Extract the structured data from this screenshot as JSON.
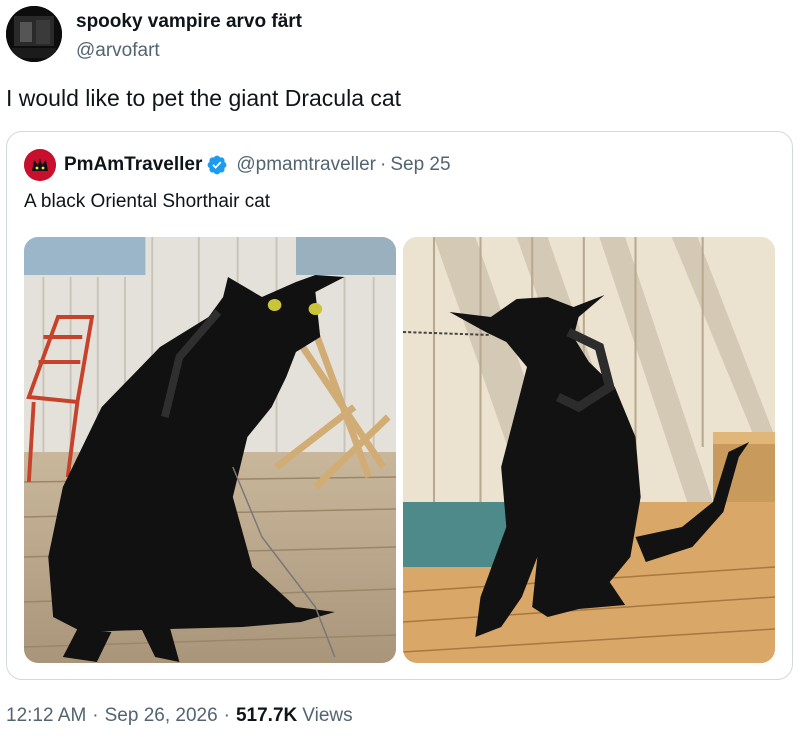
{
  "author": {
    "display_name": "spooky vampire arvo färt",
    "handle": "@arvofart",
    "avatar_icon": "profile-avatar"
  },
  "tweet": {
    "text": "I would like to pet the giant Dracula cat"
  },
  "quoted_tweet": {
    "display_name": "PmAmTraveller",
    "verified_icon": "verified-badge-icon",
    "handle": "@pmamtraveller",
    "separator": "·",
    "date": "Sep 25",
    "text": "A black Oriental Shorthair cat",
    "media": [
      {
        "name": "photo-cat-sitting-deck"
      },
      {
        "name": "photo-cat-sitting-sunlight"
      }
    ]
  },
  "meta": {
    "time": "12:12 AM",
    "sep1": "·",
    "date": "Sep 26, 2026",
    "sep2": "·",
    "views_count": "517.7K",
    "views_label": "Views"
  },
  "colors": {
    "text_primary": "#0f1419",
    "text_secondary": "#536471",
    "border": "#cfd9de",
    "verified_blue": "#1d9bf0"
  }
}
